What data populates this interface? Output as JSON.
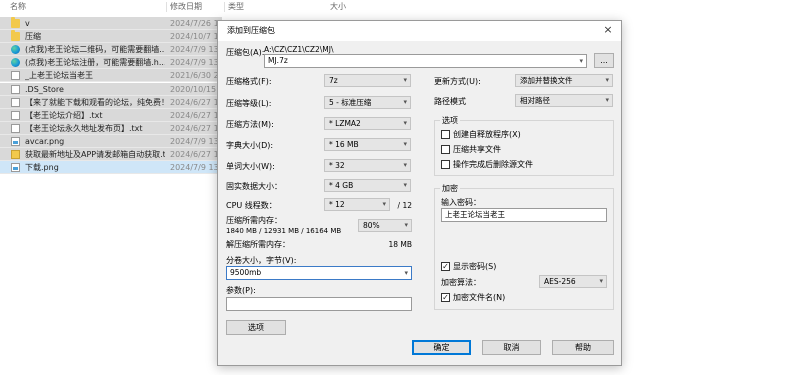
{
  "explorer": {
    "columns": {
      "name": "名称",
      "date": "修改日期",
      "type": "类型",
      "size": "大小"
    },
    "files": [
      {
        "icon": "folder-icon",
        "name": "v",
        "date": "2024/7/26 13:"
      },
      {
        "icon": "folder-icon",
        "name": "压缩",
        "date": "2024/10/7 10"
      },
      {
        "icon": "edge-icon",
        "name": "(点我)老王论坛二维码，可能需要翻墙...",
        "date": "2024/7/9 13:1"
      },
      {
        "icon": "edge-icon",
        "name": "(点我)老王论坛注册，可能需要翻墙.h...",
        "date": "2024/7/9 13:1"
      },
      {
        "icon": "doc-icon",
        "name": "_上老王论坛当老王",
        "date": "2021/6/30 22:"
      },
      {
        "icon": "doc-icon",
        "name": ".DS_Store",
        "date": "2020/10/15 2"
      },
      {
        "icon": "doc-icon",
        "name": "【来了就能下载和观看的论坛，纯免费！...",
        "date": "2024/6/27 13"
      },
      {
        "icon": "doc-icon",
        "name": "【老王论坛介绍】.txt",
        "date": "2024/6/27 13"
      },
      {
        "icon": "doc-icon",
        "name": "【老王论坛永久地址发布页】.txt",
        "date": "2024/6/27 13"
      },
      {
        "icon": "image-icon",
        "name": "avcar.png",
        "date": "2024/7/9 13:1"
      },
      {
        "icon": "zip-icon",
        "name": "获取最新地址及APP请发邮箱自动获取.txt",
        "date": "2024/6/27 13"
      },
      {
        "icon": "image-icon",
        "name": "下载.png",
        "date": "2024/7/9 13:1"
      }
    ]
  },
  "dialog": {
    "title": "添加到压缩包",
    "close": "×",
    "archive_label": "压缩包(A):",
    "archive_path": "A:\\CZ\\CZ1\\CZ2\\MJ\\",
    "archive_name": "MJ.7z",
    "browse": "...",
    "left": {
      "format": {
        "label": "压缩格式(F):",
        "value": "7z"
      },
      "level": {
        "label": "压缩等级(L):",
        "value": "5 - 标准压缩"
      },
      "method": {
        "label": "压缩方法(M):",
        "value": "* LZMA2"
      },
      "dict": {
        "label": "字典大小(D):",
        "value": "* 16 MB"
      },
      "word": {
        "label": "单词大小(W):",
        "value": "* 32"
      },
      "solid": {
        "label": "固实数据大小：",
        "value": "* 4 GB"
      },
      "threads": {
        "label": "CPU 线程数：",
        "value": "* 12",
        "max": "/ 12"
      },
      "mem_label": "压缩所需内存：",
      "mem_detail": "1840 MB / 12931 MB / 16164 MB",
      "mem_percent": "80%",
      "decomp_label": "解压缩所需内存：",
      "decomp_value": "18 MB",
      "split_label": "分卷大小，字节(V):",
      "split_value": "9500mb",
      "params_label": "参数(P):",
      "params_value": "",
      "options_button": "选项"
    },
    "right": {
      "update_label": "更新方式(U):",
      "update_value": "添加并替换文件",
      "path_label": "路径模式",
      "path_value": "相对路径",
      "options_group": "选项",
      "sfx": "创建自释放程序(X)",
      "shared": "压缩共享文件",
      "delete": "操作完成后删除源文件",
      "encryption_group": "加密",
      "password_label": "输入密码：",
      "password_value": "上老王论坛当老王",
      "show_password": "显示密码(S)",
      "enc_method_label": "加密算法：",
      "enc_method_value": "AES-256",
      "enc_names": "加密文件名(N)",
      "checked_mark": "✓"
    },
    "buttons": {
      "ok": "确定",
      "cancel": "取消",
      "help": "帮助"
    }
  }
}
